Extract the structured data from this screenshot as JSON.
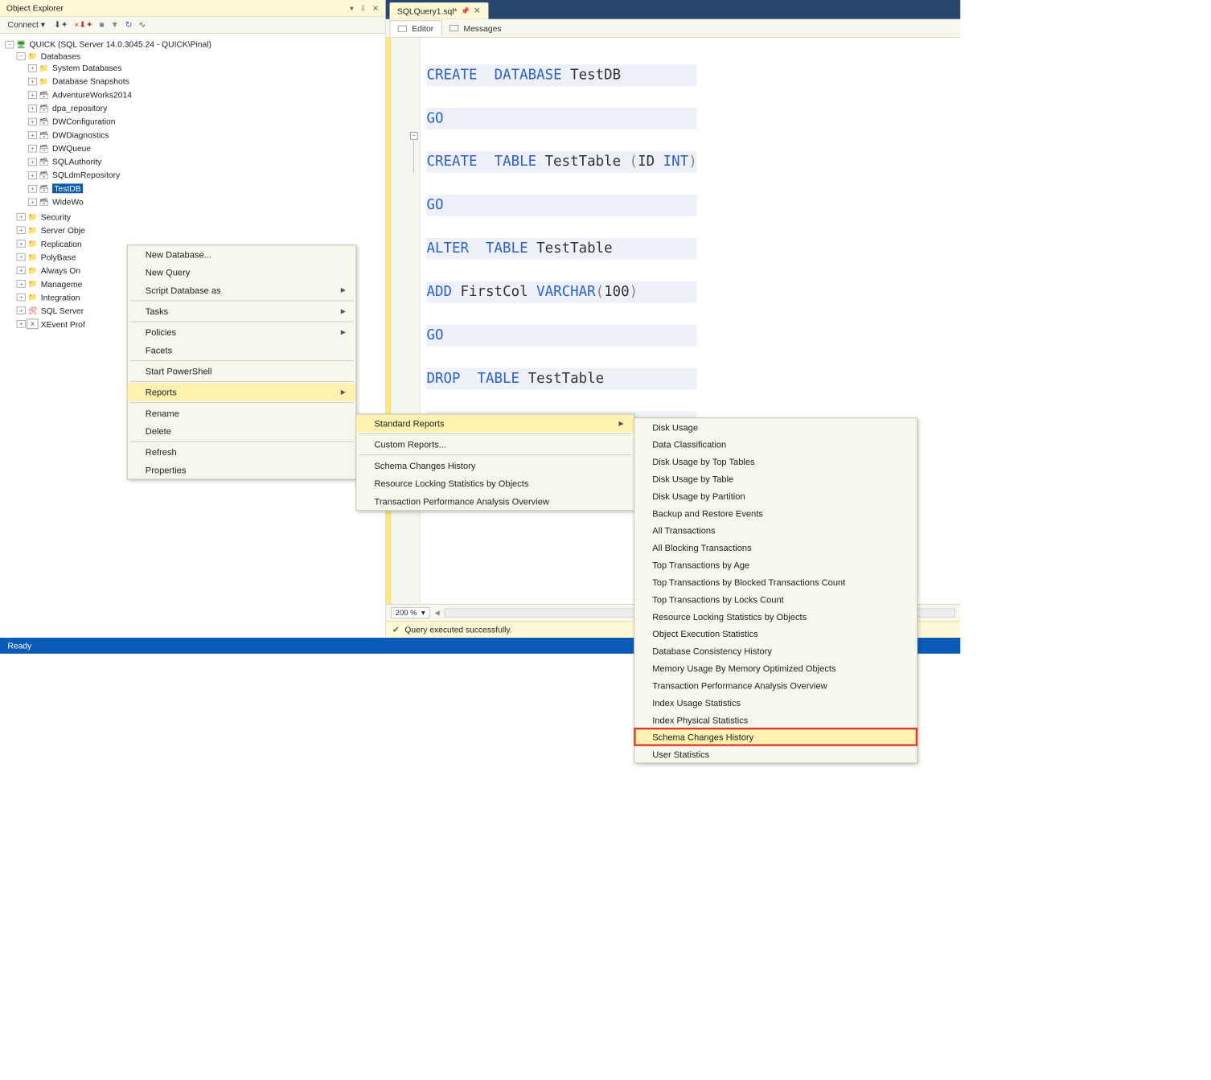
{
  "objectExplorer": {
    "title": "Object Explorer",
    "connectLabel": "Connect",
    "server": "QUICK (SQL Server 14.0.3045.24 - QUICK\\Pinal)",
    "databasesLabel": "Databases",
    "databases": {
      "sysDatabases": "System Databases",
      "snapshots": "Database Snapshots",
      "items": [
        "AdventureWorks2014",
        "dpa_repository",
        "DWConfiguration",
        "DWDiagnostics",
        "DWQueue",
        "SQLAuthority",
        "SQLdmRepository",
        "TestDB",
        "WideWo"
      ]
    },
    "topFolders": [
      "Security",
      "Server Obje",
      "Replication",
      "PolyBase",
      "Always On",
      "Manageme",
      "Integration",
      "SQL Server",
      "XEvent Prof"
    ]
  },
  "editorTab": "SQLQuery1.sql*",
  "subtabs": {
    "editor": "Editor",
    "messages": "Messages"
  },
  "code": {
    "l1a": "CREATE",
    "l1b": "DATABASE",
    "l1c": "TestDB",
    "go": "GO",
    "l3a": "CREATE",
    "l3b": "TABLE",
    "l3c": "TestTable",
    "l3d": "(",
    "l3e": "ID",
    "l3f": "INT",
    "l3g": ")",
    "l5a": "ALTER",
    "l5b": "TABLE",
    "l5c": "TestTable",
    "l6a": "ADD",
    "l6b": "FirstCol",
    "l6c": "VARCHAR",
    "l6d": "(",
    "l6e": "100",
    "l6f": ")",
    "l8a": "DROP",
    "l8b": "TABLE",
    "l8c": "TestTable"
  },
  "zoom": "200 %",
  "queryStatus": "Query executed successfully.",
  "statusbar": "Ready",
  "ctxMenu1": {
    "newDb": "New Database...",
    "newQuery": "New Query",
    "scriptAs": "Script Database as",
    "tasks": "Tasks",
    "policies": "Policies",
    "facets": "Facets",
    "powershell": "Start PowerShell",
    "reports": "Reports",
    "rename": "Rename",
    "delete": "Delete",
    "refresh": "Refresh",
    "properties": "Properties"
  },
  "ctxMenu2": {
    "standard": "Standard Reports",
    "custom": "Custom Reports...",
    "schemaHist": "Schema Changes History",
    "resLock": "Resource Locking Statistics by Objects",
    "txnPerf": "Transaction Performance Analysis Overview"
  },
  "ctxMenu3": [
    "Disk Usage",
    "Data Classification",
    "Disk Usage by Top Tables",
    "Disk Usage by Table",
    "Disk Usage by Partition",
    "Backup and Restore Events",
    "All Transactions",
    "All Blocking Transactions",
    "Top Transactions by Age",
    "Top Transactions by Blocked Transactions Count",
    "Top Transactions by Locks Count",
    "Resource Locking Statistics by Objects",
    "Object Execution Statistics",
    "Database Consistency History",
    "Memory Usage By Memory Optimized Objects",
    "Transaction Performance Analysis Overview",
    "Index Usage Statistics",
    "Index Physical Statistics",
    "Schema Changes History",
    "User Statistics"
  ],
  "ctxMenu3Highlight": "Schema Changes History"
}
